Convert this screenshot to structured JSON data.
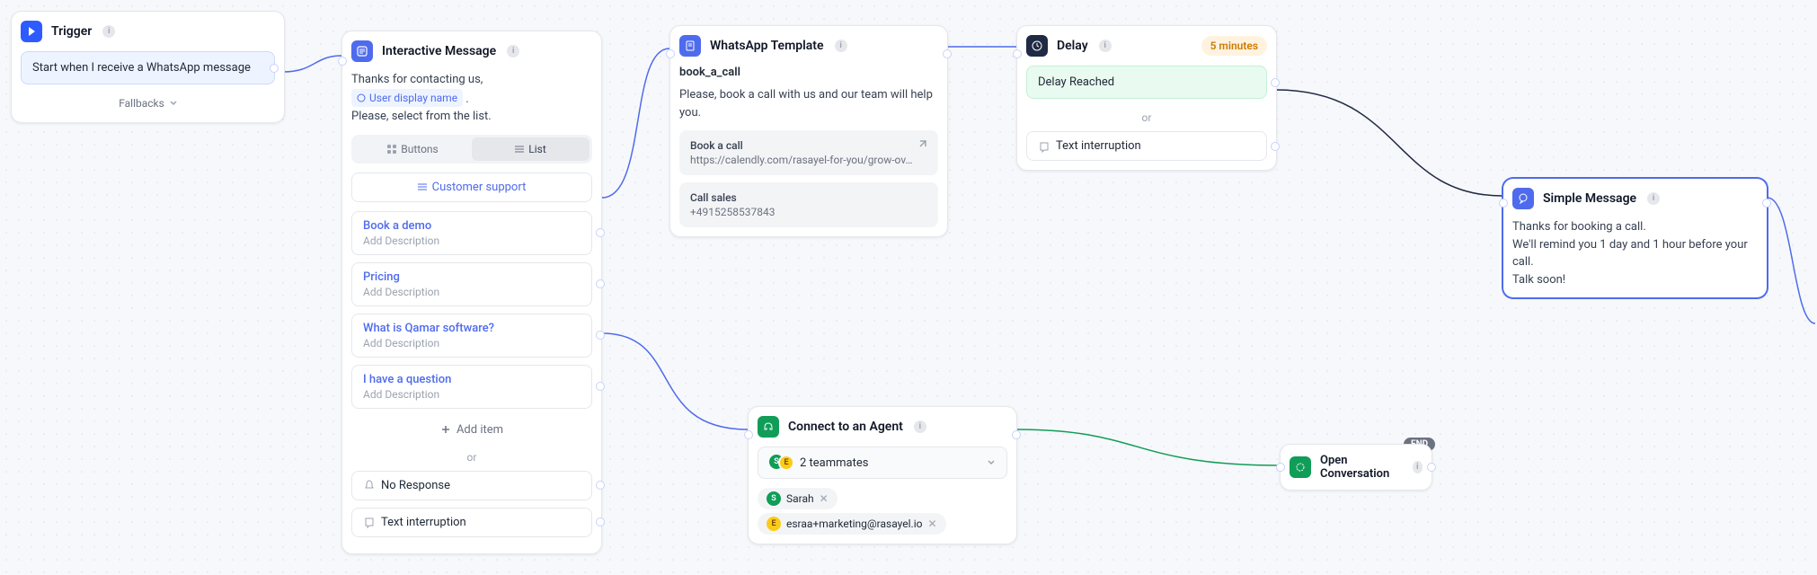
{
  "trigger": {
    "title": "Trigger",
    "start_text": "Start when I receive a WhatsApp message",
    "fallbacks": "Fallbacks"
  },
  "interactive": {
    "title": "Interactive Message",
    "body_pre": "Thanks for contacting us,",
    "body_post": ".",
    "body_line2": "Please, select from the list.",
    "token": "User display name",
    "tab_buttons": "Buttons",
    "tab_list": "List",
    "list_header": "Customer support",
    "options": [
      {
        "title": "Book a demo",
        "sub": "Add Description"
      },
      {
        "title": "Pricing",
        "sub": "Add Description"
      },
      {
        "title": "What is Qamar software?",
        "sub": "Add Description"
      },
      {
        "title": "I have a question",
        "sub": "Add Description"
      }
    ],
    "add_item": "Add item",
    "or": "or",
    "no_response": "No Response",
    "text_interruption": "Text interruption"
  },
  "template": {
    "title": "WhatsApp Template",
    "name": "book_a_call",
    "body": "Please, book a call with us and our team will help you.",
    "action1_title": "Book a call",
    "action1_sub": "https://calendly.com/rasayel-for-you/grow-ov…",
    "action2_title": "Call sales",
    "action2_sub": "+4915258537843"
  },
  "delay": {
    "title": "Delay",
    "badge": "5 minutes",
    "reached": "Delay Reached",
    "or": "or",
    "text_interruption": "Text interruption"
  },
  "agent": {
    "title": "Connect to an Agent",
    "count": "2 teammates",
    "person1": "Sarah",
    "person2": "esraa+marketing@rasayel.io"
  },
  "open": {
    "title": "Open Conversation",
    "end": "END"
  },
  "simple": {
    "title": "Simple Message",
    "body": "Thanks for booking a call.\nWe'll remind you 1 day and 1 hour before your call.\nTalk soon!"
  }
}
